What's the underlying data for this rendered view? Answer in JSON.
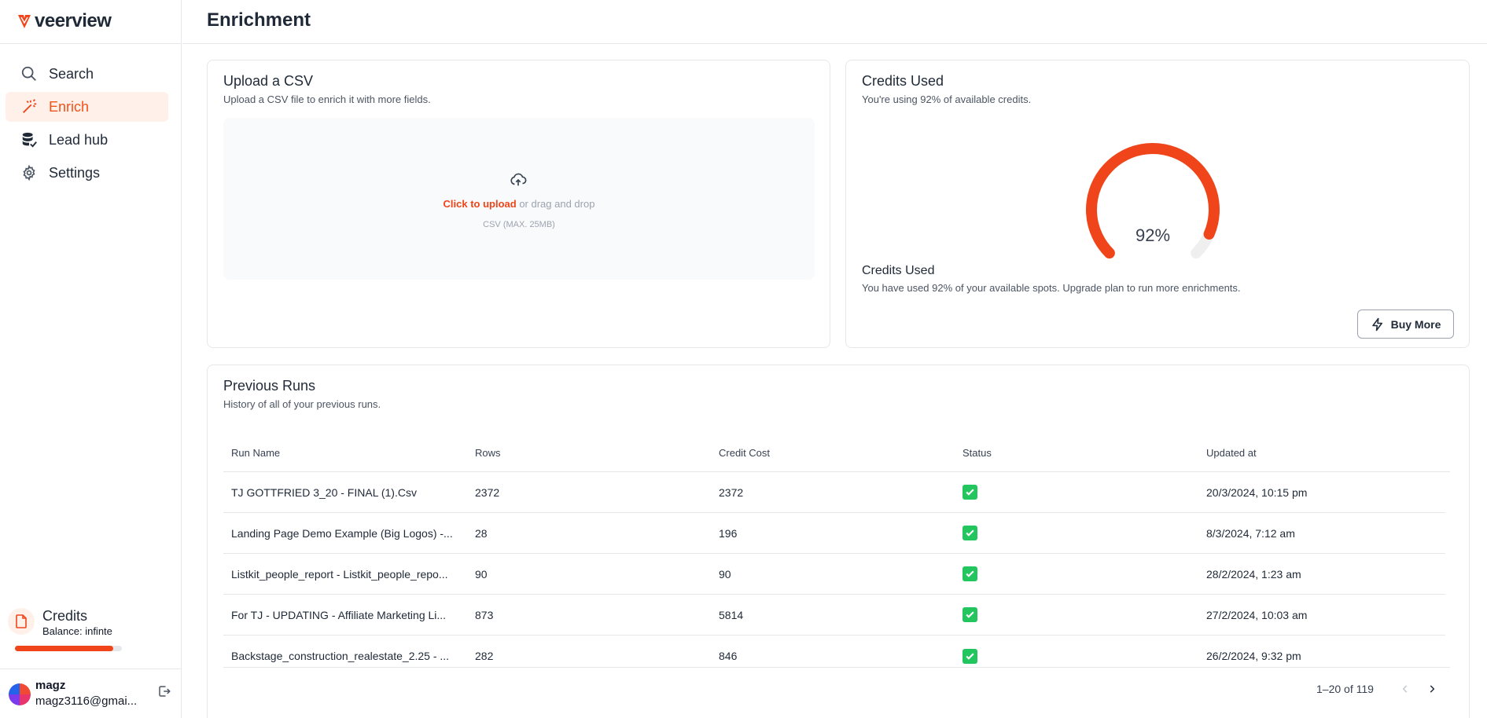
{
  "app": {
    "logo_text": "veerview",
    "brand_color": "#f0451a"
  },
  "nav": [
    {
      "label": "Search",
      "icon": "search-icon",
      "active": false
    },
    {
      "label": "Enrich",
      "icon": "magic-wand-icon",
      "active": true
    },
    {
      "label": "Lead hub",
      "icon": "database-icon",
      "active": false
    },
    {
      "label": "Settings",
      "icon": "gear-icon",
      "active": false
    }
  ],
  "sidebar_credits": {
    "title": "Credits",
    "balance": "Balance: infinte",
    "progress": 0.92
  },
  "user": {
    "name": "magz",
    "email": "magz3116@gmai..."
  },
  "header": {
    "title": "Enrichment"
  },
  "upload": {
    "title": "Upload a CSV",
    "subtitle": "Upload a CSV file to enrich it with more fields.",
    "click_text": "Click to upload",
    "drag_text": " or drag and drop",
    "hint": "CSV (MAX. 25MB)"
  },
  "credits_used": {
    "title": "Credits Used",
    "subtitle": "You're using 92% of available credits.",
    "percent_label": "92%",
    "percent_value": 92,
    "sub_title": "Credits Used",
    "sub_desc": "You have used 92% of your available spots. Upgrade plan to run more enrichments.",
    "buy_label": "Buy More"
  },
  "runs": {
    "title": "Previous Runs",
    "subtitle": "History of all of your previous runs.",
    "columns": [
      "Run Name",
      "Rows",
      "Credit Cost",
      "Status",
      "Updated at"
    ],
    "rows": [
      {
        "name": "TJ GOTTFRIED 3_20 - FINAL (1).Csv",
        "rows": "2372",
        "cost": "2372",
        "updated": "20/3/2024, 10:15 pm"
      },
      {
        "name": "Landing Page Demo Example (Big Logos) -...",
        "rows": "28",
        "cost": "196",
        "updated": "8/3/2024, 7:12 am"
      },
      {
        "name": "Listkit_people_report - Listkit_people_repo...",
        "rows": "90",
        "cost": "90",
        "updated": "28/2/2024, 1:23 am"
      },
      {
        "name": "For TJ - UPDATING - Affiliate Marketing Li...",
        "rows": "873",
        "cost": "5814",
        "updated": "27/2/2024, 10:03 am"
      },
      {
        "name": "Backstage_construction_realestate_2.25 - ...",
        "rows": "282",
        "cost": "846",
        "updated": "26/2/2024, 9:32 pm"
      }
    ],
    "pagination": "1–20 of 119"
  }
}
